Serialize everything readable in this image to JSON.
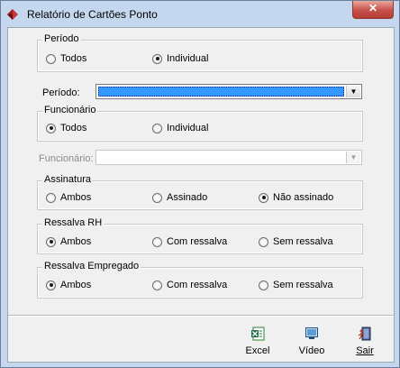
{
  "window": {
    "title": "Relatório de Cartões Ponto",
    "close_symbol": "✕"
  },
  "group_periodo": {
    "legend": "Período",
    "options": [
      {
        "label": "Todos",
        "selected": false
      },
      {
        "label": "Individual",
        "selected": true
      }
    ]
  },
  "periodo_combo": {
    "label": "Período:",
    "value": ""
  },
  "group_funcionario": {
    "legend": "Funcionário",
    "options": [
      {
        "label": "Todos",
        "selected": true
      },
      {
        "label": "Individual",
        "selected": false
      }
    ]
  },
  "funcionario_combo": {
    "label": "Funcionário:",
    "value": ""
  },
  "group_assinatura": {
    "legend": "Assinatura",
    "options": [
      {
        "label": "Ambos",
        "selected": false
      },
      {
        "label": "Assinado",
        "selected": false
      },
      {
        "label": "Não assinado",
        "selected": true
      }
    ]
  },
  "group_ressalva_rh": {
    "legend": "Ressalva RH",
    "options": [
      {
        "label": "Ambos",
        "selected": true
      },
      {
        "label": "Com ressalva",
        "selected": false
      },
      {
        "label": "Sem ressalva",
        "selected": false
      }
    ]
  },
  "group_ressalva_emp": {
    "legend": "Ressalva Empregado",
    "options": [
      {
        "label": "Ambos",
        "selected": true
      },
      {
        "label": "Com ressalva",
        "selected": false
      },
      {
        "label": "Sem ressalva",
        "selected": false
      }
    ]
  },
  "toolbar": {
    "excel_label": "Excel",
    "video_label": "Vídeo",
    "sair_label": "Sair"
  },
  "colors": {
    "title_bg": "#c4d7ee",
    "selection": "#3399ff",
    "close": "#c7504a"
  }
}
